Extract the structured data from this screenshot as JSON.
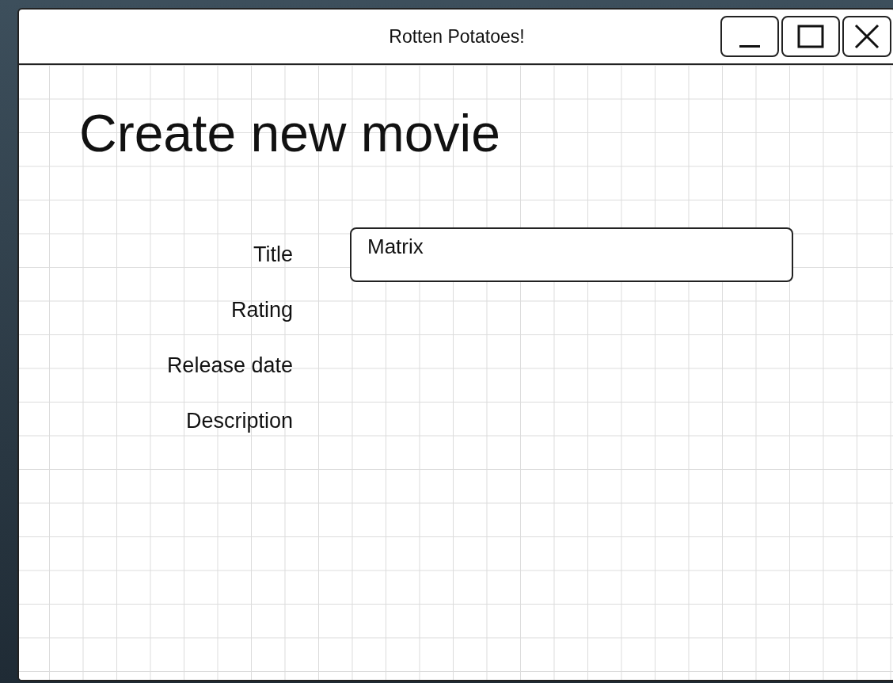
{
  "window": {
    "title": "Rotten Potatoes!"
  },
  "heading": "Create new movie",
  "fields": [
    {
      "label": "Title",
      "value": "Matrix"
    },
    {
      "label": "Rating"
    },
    {
      "label": "Release date"
    },
    {
      "label": "Description"
    }
  ]
}
